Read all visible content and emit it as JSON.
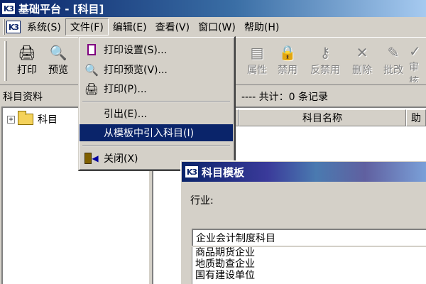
{
  "window": {
    "title": "基础平台 - [科目]",
    "icon_text": "K3"
  },
  "menubar": {
    "items": [
      {
        "label": "系统(S)"
      },
      {
        "label": "文件(F)"
      },
      {
        "label": "编辑(E)"
      },
      {
        "label": "查看(V)"
      },
      {
        "label": "窗口(W)"
      },
      {
        "label": "帮助(H)"
      }
    ]
  },
  "toolbar": {
    "print": "打印",
    "preview": "预览",
    "properties": "属性",
    "disable": "禁用",
    "undisable": "反禁用",
    "delete": "删除",
    "batch_edit": "批改",
    "review": "审核"
  },
  "left_panel": {
    "header": "科目资料",
    "tree_root": "科目"
  },
  "right_panel": {
    "record_info": "---- 共计：0 条记录",
    "col_name": "科目名称",
    "col_aux": "助"
  },
  "file_menu": {
    "print_setup": "打印设置(S)...",
    "print_preview": "打印预览(V)...",
    "print": "打印(P)...",
    "export": "引出(E)...",
    "import_template": "从模板中引入科目(I)",
    "close": "关闭(X)"
  },
  "dialog": {
    "title": "科目模板",
    "industry_label": "行业:",
    "selected_value": "企业会计制度科目",
    "options": [
      "商品期货企业",
      "地质勘查企业",
      "国有建设单位"
    ]
  },
  "colors": {
    "titlebar": "#0a246a",
    "selection": "#0a246a",
    "face": "#d4d0c8"
  }
}
